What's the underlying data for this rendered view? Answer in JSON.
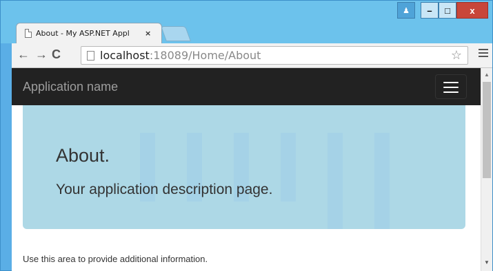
{
  "browser": {
    "tab": {
      "title": "About - My ASP.NET Appl",
      "close_glyph": "×"
    },
    "window_buttons": {
      "user": "♟",
      "minimize": "–",
      "maximize": "□",
      "close": "x"
    },
    "toolbar": {
      "back": "←",
      "forward": "→",
      "reload": "C"
    },
    "address": {
      "host": "localhost",
      "path": ":18089/Home/About"
    },
    "bookmark_glyph": "☆"
  },
  "navbar": {
    "brand": "Application name"
  },
  "jumbotron": {
    "title": "About.",
    "description": "Your application description page."
  },
  "body": {
    "info": "Use this area to provide additional information."
  },
  "scrollbar": {
    "up": "▲",
    "down": "▼"
  },
  "colors": {
    "navbar": "#222222",
    "jumbotron": "#add8e6",
    "titlebar": "#6cc2ec"
  }
}
